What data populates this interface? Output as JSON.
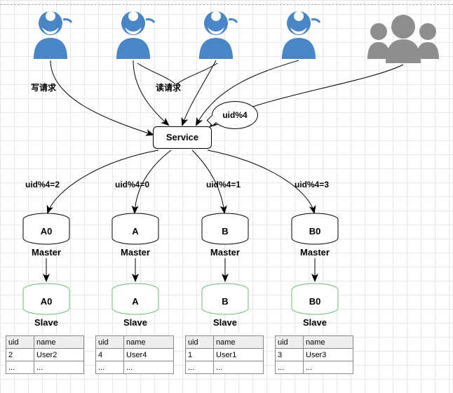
{
  "labels": {
    "write_request": "写请求",
    "read_request": "读请求",
    "service": "Service",
    "bubble": "uid%4"
  },
  "shards": [
    {
      "cond": "uid%4=2",
      "db": "A0",
      "master": "Master",
      "slave": "Slave",
      "slaveDb": "A0"
    },
    {
      "cond": "uid%4=0",
      "db": "A",
      "master": "Master",
      "slave": "Slave",
      "slaveDb": "A"
    },
    {
      "cond": "uid%4=1",
      "db": "B",
      "master": "Master",
      "slave": "Slave",
      "slaveDb": "B"
    },
    {
      "cond": "uid%4=3",
      "db": "B0",
      "master": "Master",
      "slave": "Slave",
      "slaveDb": "B0"
    }
  ],
  "tables": {
    "headers": [
      "uid",
      "name"
    ],
    "data": [
      [
        [
          "2",
          "User2"
        ],
        [
          "...",
          "..."
        ]
      ],
      [
        [
          "4",
          "User4"
        ],
        [
          "...",
          "..."
        ]
      ],
      [
        [
          "1",
          "User1"
        ],
        [
          "...",
          "..."
        ]
      ],
      [
        [
          "3",
          "User3"
        ],
        [
          "...",
          "..."
        ]
      ]
    ]
  },
  "colors": {
    "user": "#4a86c5",
    "group": "#8e8e8e",
    "slave": "#7fc97f"
  },
  "chart_data": {
    "type": "diagram",
    "description": "Database sharding by uid%4. Multiple clients send write/read requests to a Service layer. Service routes by uid%4 to 4 master DBs (A0, A, B, B0), each replicating to a slave with a user table.",
    "routing_key": "uid%4",
    "partitions": [
      {
        "value": 0,
        "master": "A",
        "slave": "A",
        "rows": [
          {
            "uid": 4,
            "name": "User4"
          }
        ]
      },
      {
        "value": 1,
        "master": "B",
        "slave": "B",
        "rows": [
          {
            "uid": 1,
            "name": "User1"
          }
        ]
      },
      {
        "value": 2,
        "master": "A0",
        "slave": "A0",
        "rows": [
          {
            "uid": 2,
            "name": "User2"
          }
        ]
      },
      {
        "value": 3,
        "master": "B0",
        "slave": "B0",
        "rows": [
          {
            "uid": 3,
            "name": "User3"
          }
        ]
      }
    ],
    "requests": [
      "写请求",
      "读请求"
    ]
  }
}
